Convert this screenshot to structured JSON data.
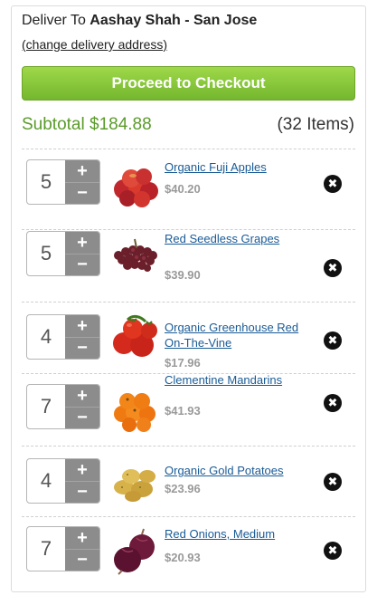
{
  "header": {
    "deliver_prefix": "Deliver To",
    "deliver_name": "Aashay Shah - San Jose",
    "change_link": "(change delivery address)"
  },
  "checkout": {
    "label": "Proceed to Checkout"
  },
  "summary": {
    "subtotal": "Subtotal $184.88",
    "items_count": "(32 Items)"
  },
  "cart": {
    "items": [
      {
        "qty": "5",
        "name": "Organic Fuji Apples",
        "price": "$40.20",
        "icon": "apples-icon"
      },
      {
        "qty": "5",
        "name": "Red Seedless Grapes",
        "price": "$39.90",
        "icon": "grapes-icon"
      },
      {
        "qty": "4",
        "name": "Organic Greenhouse Red On-The-Vine",
        "price": "$17.96",
        "icon": "tomatoes-icon"
      },
      {
        "qty": "7",
        "name": "Clementine Mandarins",
        "price": "$41.93",
        "icon": "mandarins-icon"
      },
      {
        "qty": "4",
        "name": "Organic Gold Potatoes",
        "price": "$23.96",
        "icon": "potatoes-icon"
      },
      {
        "qty": "7",
        "name": "Red Onions, Medium",
        "price": "$20.93",
        "icon": "onions-icon"
      }
    ],
    "plus_symbol": "+",
    "minus_symbol": "−",
    "remove_symbol": "✖"
  },
  "colors": {
    "accent_green": "#74b72e",
    "subtotal_green": "#5a9b2a",
    "link_blue": "#1a5b96"
  }
}
